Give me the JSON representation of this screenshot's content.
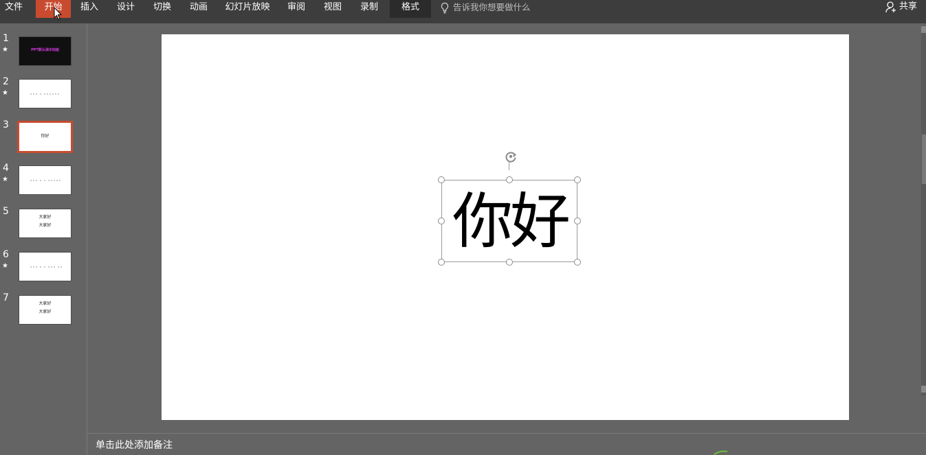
{
  "ribbon": {
    "tabs": [
      {
        "label": "文件",
        "state": "normal"
      },
      {
        "label": "开始",
        "state": "active"
      },
      {
        "label": "插入",
        "state": "normal"
      },
      {
        "label": "设计",
        "state": "normal"
      },
      {
        "label": "切换",
        "state": "normal"
      },
      {
        "label": "动画",
        "state": "normal"
      },
      {
        "label": "幻灯片放映",
        "state": "normal"
      },
      {
        "label": "审阅",
        "state": "normal"
      },
      {
        "label": "视图",
        "state": "normal"
      },
      {
        "label": "录制",
        "state": "normal"
      },
      {
        "label": "格式",
        "state": "contextual"
      }
    ],
    "tell_me_placeholder": "告诉我你想要做什么",
    "tell_me_icon": "lightbulb-icon",
    "share_label": "共享",
    "share_icon": "person-icon",
    "active_color": "#c84b2f"
  },
  "thumbnails": [
    {
      "number": "1",
      "has_animation": true,
      "theme": "dark",
      "title": "PPT默认演示动画",
      "selected": false
    },
    {
      "number": "2",
      "has_animation": true,
      "theme": "light",
      "selected": false
    },
    {
      "number": "3",
      "has_animation": false,
      "theme": "light",
      "lines": [
        "你好"
      ],
      "selected": true
    },
    {
      "number": "4",
      "has_animation": true,
      "theme": "light",
      "selected": false
    },
    {
      "number": "5",
      "has_animation": false,
      "theme": "light",
      "lines": [
        "大家好",
        "大家好"
      ],
      "selected": false
    },
    {
      "number": "6",
      "has_animation": true,
      "theme": "light",
      "selected": false
    },
    {
      "number": "7",
      "has_animation": false,
      "theme": "light",
      "lines": [
        "大家好",
        "大家好"
      ],
      "selected": false
    }
  ],
  "animation_marker": "★",
  "slide": {
    "text": "你好",
    "rotate_icon": "rotate-handle-icon"
  },
  "notes_placeholder": "单击此处添加备注"
}
